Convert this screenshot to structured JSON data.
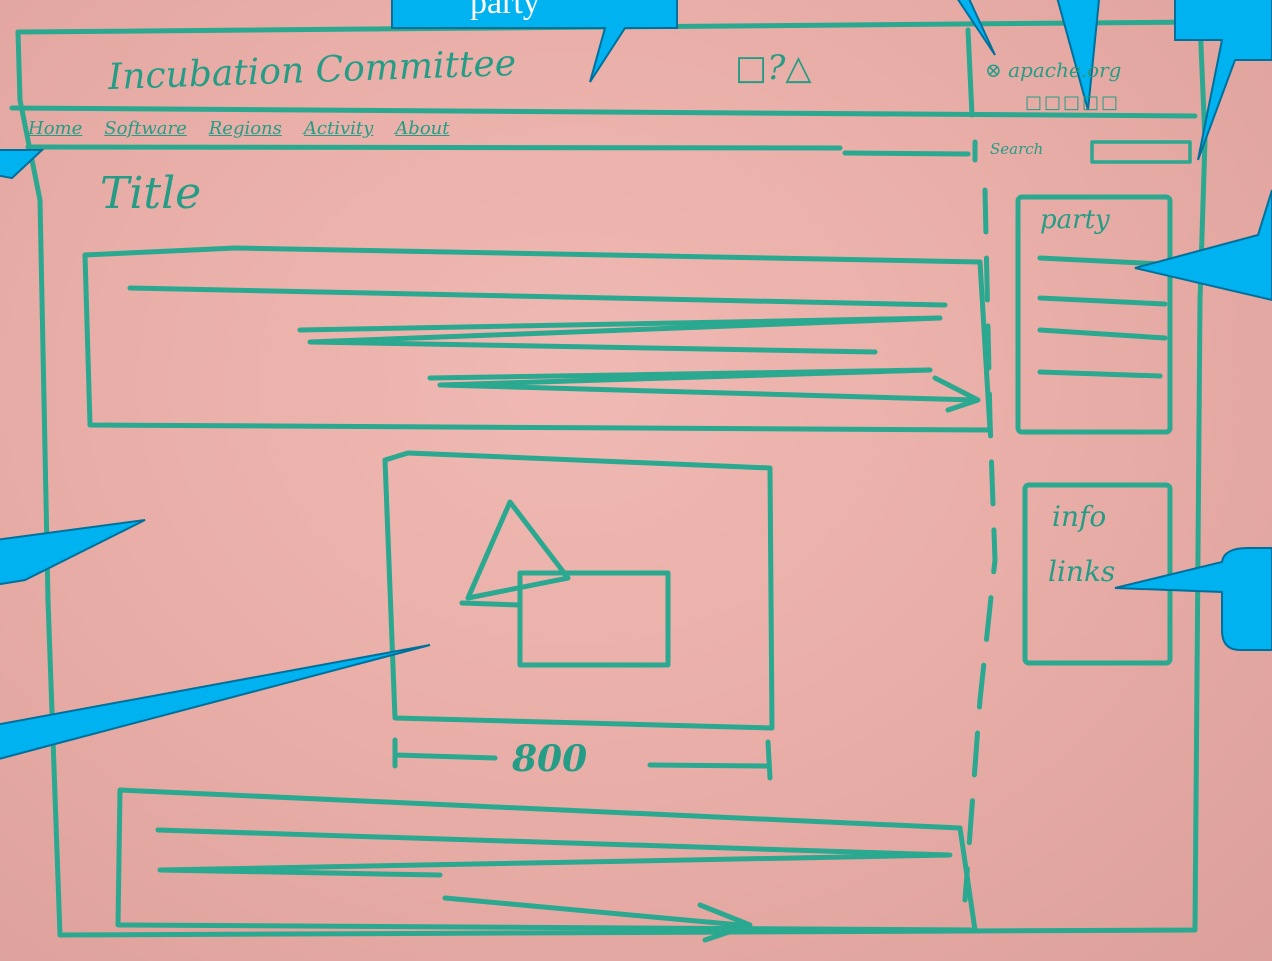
{
  "sketch": {
    "header_title": "Incubation Committee",
    "header_icons": "□?△",
    "account_text": "⊗ apache.org",
    "account_squares": "□□□□□",
    "nav_items": [
      "Home",
      "Software",
      "Regions",
      "Activity",
      "About"
    ],
    "search_label": "Search",
    "page_title": "Title",
    "party_box_title": "party",
    "info_box_lines": [
      "info",
      "links"
    ],
    "dimension_label": "800"
  },
  "callouts": {
    "top_label": "party"
  },
  "colors": {
    "board": "#e8aca6",
    "marker": "#2aa890",
    "callout_fill": "#00b2f0"
  }
}
